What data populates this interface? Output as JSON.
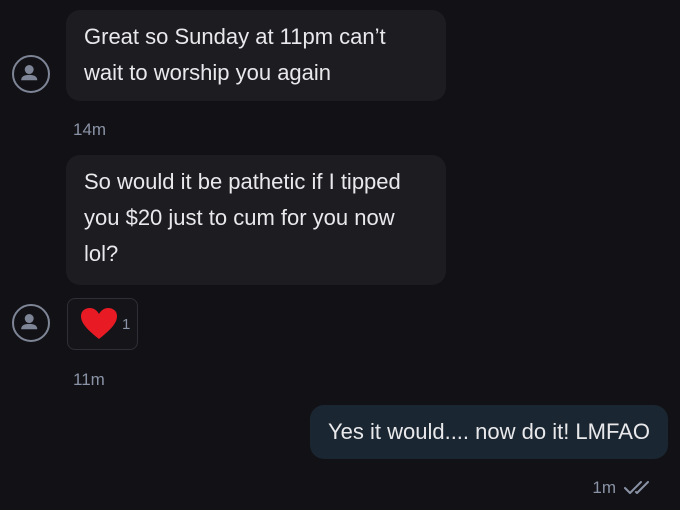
{
  "messages": {
    "first": {
      "text": "Great so Sunday at 11pm can’t wait to worship you again",
      "time": "14m"
    },
    "second": {
      "text": "So would it be pathetic if I tipped you $20 just to cum for you now lol?",
      "reaction_icon": "heart",
      "reaction_count": "1",
      "time": "11m"
    },
    "reply": {
      "text": "Yes it would.... now do it! LMFAO",
      "time": "1m",
      "status_icon": "double-check"
    }
  },
  "colors": {
    "background": "#121216",
    "incoming_bubble": "#1c1c21",
    "outgoing_bubble": "#1a2631",
    "timestamp": "#8a93a6",
    "heart": "#e81b25"
  }
}
